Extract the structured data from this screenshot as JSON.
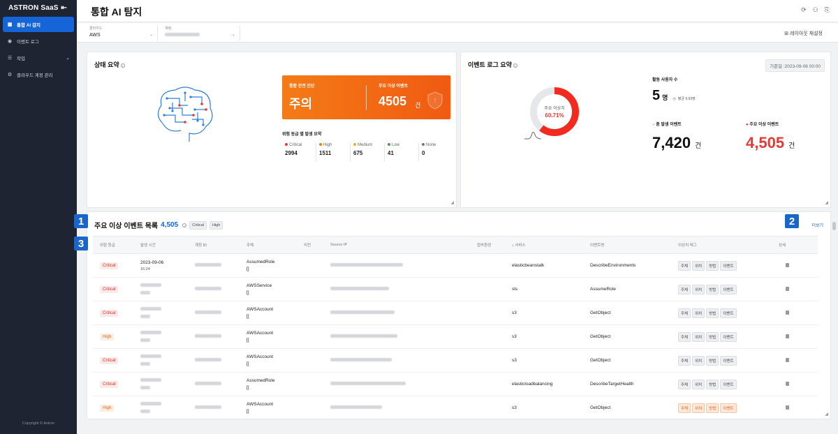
{
  "sidebar": {
    "brand": "ASTRON SaaS",
    "items": [
      {
        "label": "통합 AI 감지",
        "icon": "grid-icon",
        "active": true
      },
      {
        "label": "이벤트 로그",
        "icon": "log-icon",
        "active": false
      },
      {
        "label": "작업",
        "icon": "list-icon",
        "active": false,
        "has_submenu": true
      },
      {
        "label": "클라우드 계정 관리",
        "icon": "cloud-gear-icon",
        "active": false
      }
    ],
    "copyright": "Copyright © Astron"
  },
  "header": {
    "title": "통합 AI 탐지"
  },
  "filters": {
    "cloud": {
      "label": "클라우드",
      "value": "AWS"
    },
    "account": {
      "label": "계정",
      "value": ""
    },
    "reset_layout": "레이아웃 재설정"
  },
  "status_summary": {
    "title": "상태 요약",
    "overall_label": "통합 안전 진단",
    "overall_value": "주의",
    "events_label": "주요 이상 이벤트",
    "events_value": "4505",
    "events_unit": "건",
    "risk_title": "위험 등급 별 발생 요약",
    "risks": [
      {
        "label": "Critical",
        "value": "2994",
        "color": "#e53935"
      },
      {
        "label": "High",
        "value": "1511",
        "color": "#f57c00"
      },
      {
        "label": "Medium",
        "value": "675",
        "color": "#f9a825"
      },
      {
        "label": "Low",
        "value": "41",
        "color": "#43a047"
      },
      {
        "label": "None",
        "value": "0",
        "color": "#757575"
      }
    ]
  },
  "event_log_summary": {
    "title": "이벤트 로그 요약",
    "base_date": "기준일 :2023-09-06 00:00",
    "donut_label": "주요 이상치",
    "donut_value": "60.71%",
    "donut_fraction": 0.6071,
    "active_users_label": "활동 사용자 수",
    "active_users_value": "5",
    "active_users_unit": "명",
    "active_users_avg": "평균 9.93명",
    "total_label": "총 발생 이벤트",
    "total_value": "7,420",
    "total_unit": "건",
    "major_label": "주요 이상 이벤트",
    "major_value": "4,505",
    "major_unit": "건"
  },
  "event_list": {
    "title": "주요 이상 이벤트 목록",
    "count": "4,505",
    "chips": [
      "Critical",
      "High"
    ],
    "more": "더보기",
    "columns": [
      "위험 등급",
      "발생 시간",
      "계정 ID",
      "주체",
      "리전",
      "Source IP",
      "접속환경",
      "서비스",
      "이벤트명",
      "이상치 태그",
      "상세"
    ],
    "tags": [
      "주체",
      "위치",
      "방법",
      "이벤트"
    ],
    "rows": [
      {
        "severity": "Critical",
        "date": "2023-09-06",
        "time": "16:24",
        "principal": "AssumedRole",
        "principal_sub": "[]",
        "service": "elasticbeanstalk",
        "event": "DescribeEnvironments"
      },
      {
        "severity": "Critical",
        "date": "",
        "time": "",
        "principal": "AWSService",
        "principal_sub": "[]",
        "service": "sts",
        "event": "AssumeRole"
      },
      {
        "severity": "Critical",
        "date": "",
        "time": "",
        "principal": "AWSAccount",
        "principal_sub": "[]",
        "service": "s3",
        "event": "GetObject"
      },
      {
        "severity": "High",
        "date": "",
        "time": "",
        "principal": "AWSAccount",
        "principal_sub": "[]",
        "service": "s3",
        "event": "GetObject"
      },
      {
        "severity": "Critical",
        "date": "",
        "time": "",
        "principal": "AWSAccount",
        "principal_sub": "[]",
        "service": "s3",
        "event": "GetObject"
      },
      {
        "severity": "Critical",
        "date": "",
        "time": "",
        "principal": "AssumedRole",
        "principal_sub": "[]",
        "service": "elasticloadbalancing",
        "event": "DescribeTargetHealth"
      },
      {
        "severity": "High",
        "date": "",
        "time": "",
        "principal": "AWSAccount",
        "principal_sub": "[]",
        "service": "s3",
        "event": "GetObject",
        "tags_highlight": true
      }
    ]
  },
  "markers": [
    "1",
    "2",
    "3"
  ]
}
